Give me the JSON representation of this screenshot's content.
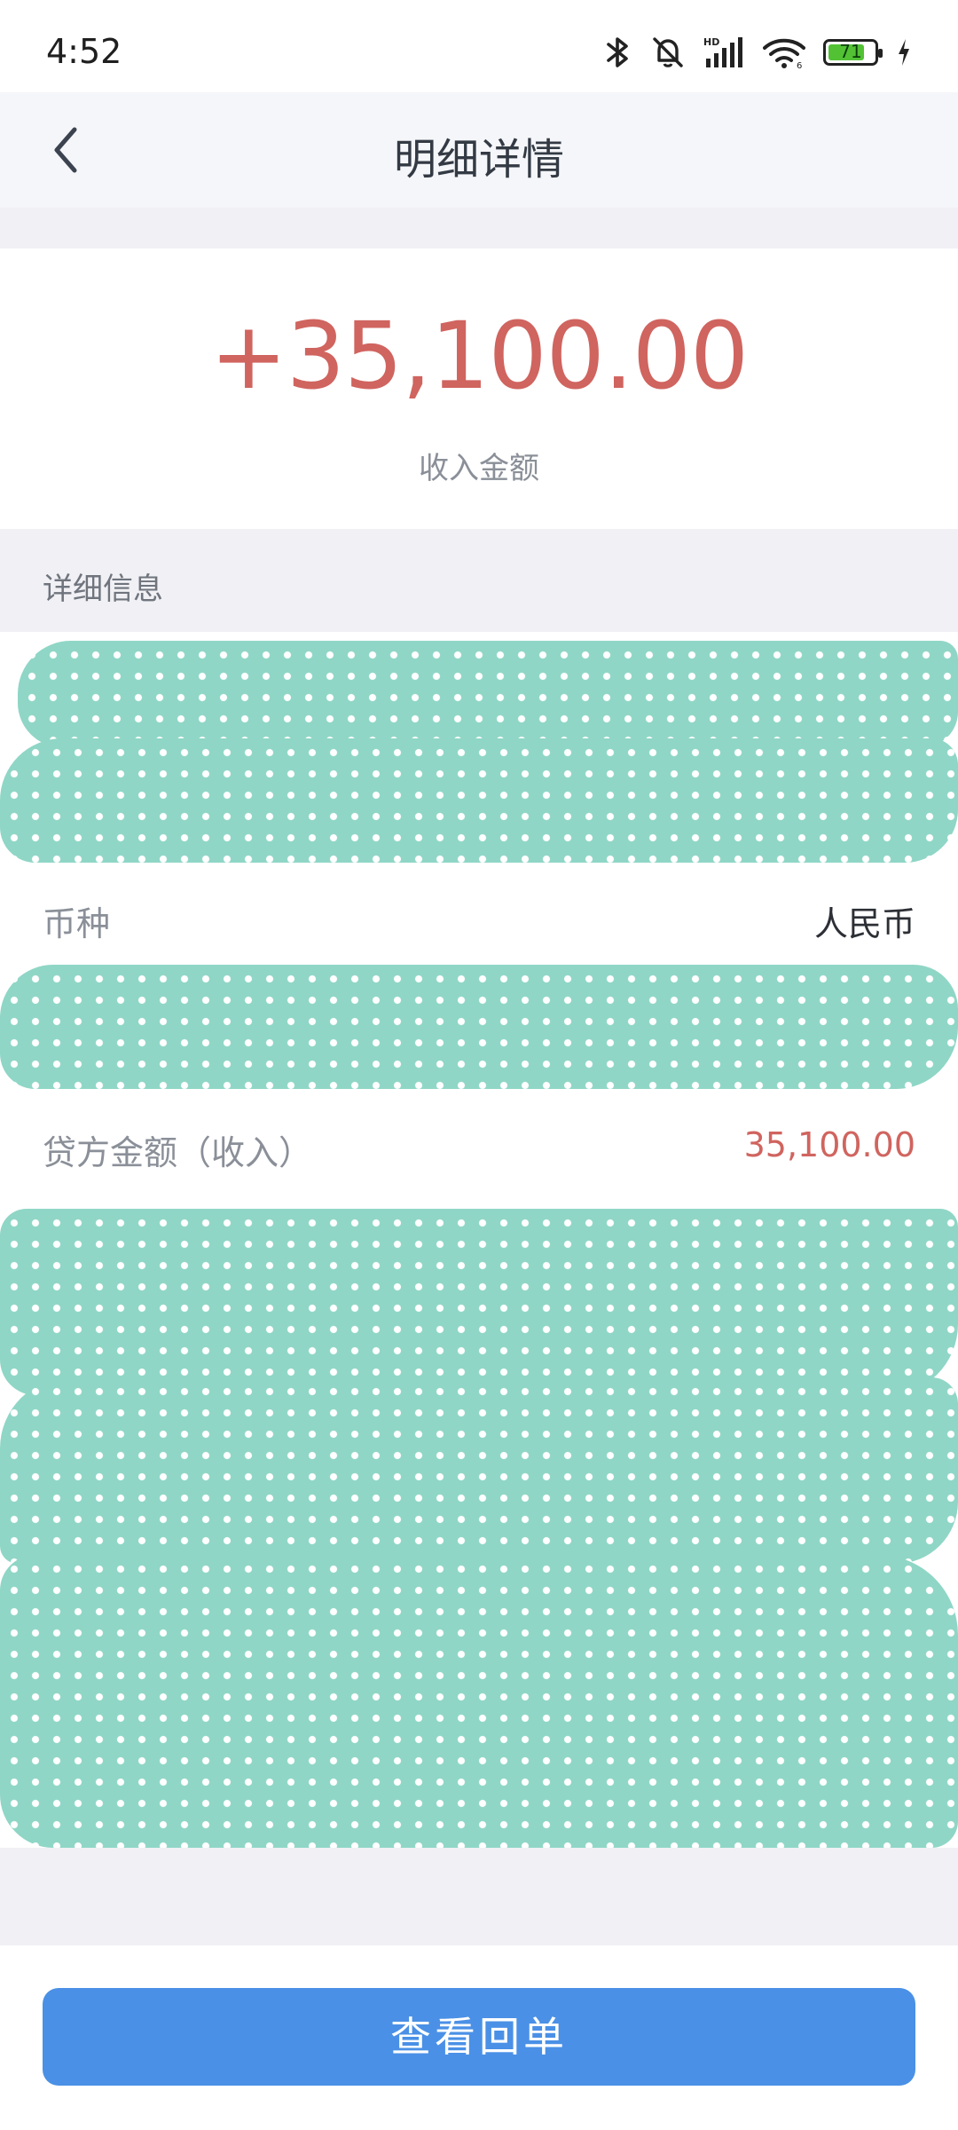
{
  "status_bar": {
    "time": "4:52",
    "battery_level": "71",
    "icons": [
      "bluetooth-icon",
      "mute-bell-icon",
      "hd-signal-icon",
      "wifi-icon",
      "battery-icon",
      "charging-icon"
    ]
  },
  "nav": {
    "title": "明细详情",
    "back_icon": "chevron-left-icon"
  },
  "amount": {
    "value": "+35,100.00",
    "label": "收入金额",
    "color": "#d0645f"
  },
  "section": {
    "title": "详细信息"
  },
  "details": {
    "rows": [
      {
        "label": "币种",
        "value": "人民币"
      },
      {
        "label": "贷方金额（收入）",
        "value": "35,100.00"
      }
    ]
  },
  "actions": {
    "view_receipt": "查看回单",
    "button_color": "#4a90e6"
  }
}
